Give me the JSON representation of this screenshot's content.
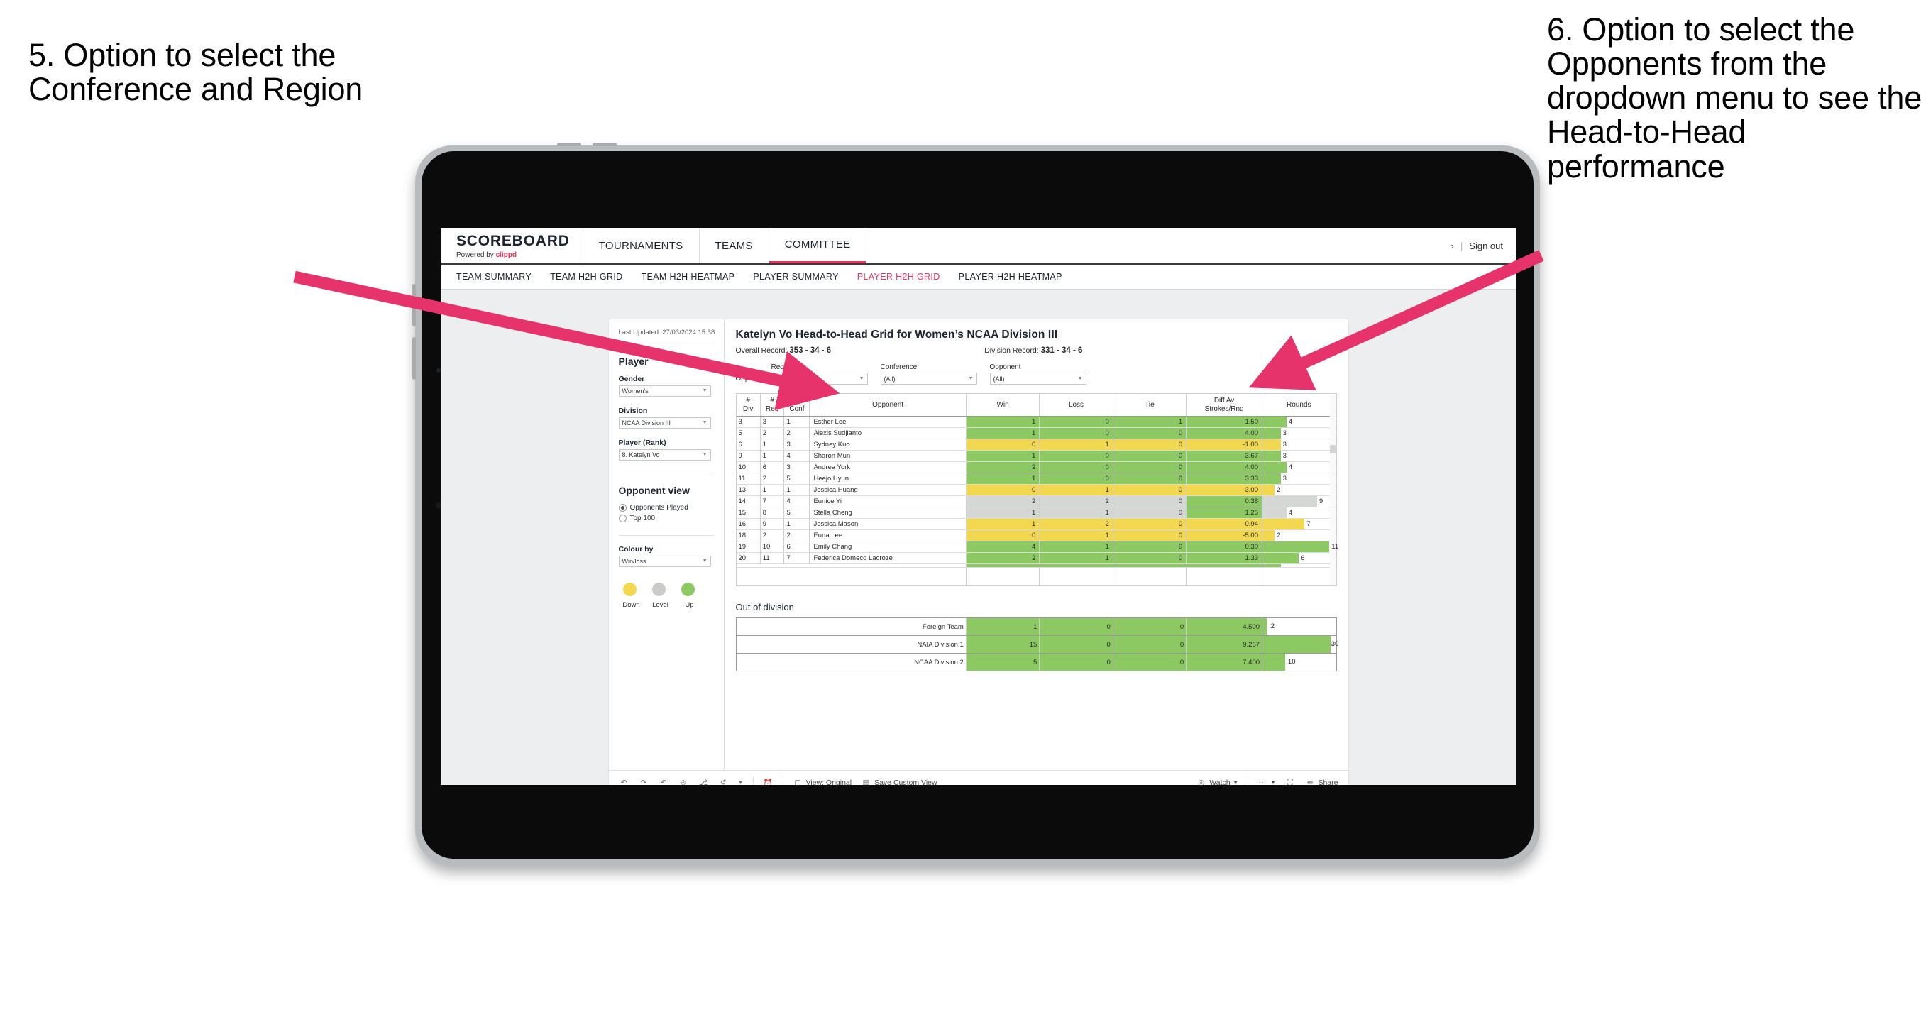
{
  "annotations": {
    "left": "5. Option to select the Conference and Region",
    "right": "6. Option to select the Opponents from the dropdown menu to see the Head-to-Head performance",
    "arrow_color": "#e6336b"
  },
  "app": {
    "logo": {
      "word": "SCOREBOARD",
      "powered_prefix": "Powered by ",
      "powered_brand": "clippd"
    },
    "topnav": [
      {
        "label": "TOURNAMENTS",
        "active": false
      },
      {
        "label": "TEAMS",
        "active": false
      },
      {
        "label": "COMMITTEE",
        "active": true
      }
    ],
    "topbar_right": {
      "chevron": "›",
      "separator": "|",
      "sign_out": "Sign out"
    },
    "subnav": [
      {
        "label": "TEAM SUMMARY",
        "active": false
      },
      {
        "label": "TEAM H2H GRID",
        "active": false
      },
      {
        "label": "TEAM H2H HEATMAP",
        "active": false
      },
      {
        "label": "PLAYER SUMMARY",
        "active": false
      },
      {
        "label": "PLAYER H2H GRID",
        "active": true
      },
      {
        "label": "PLAYER H2H HEATMAP",
        "active": false
      }
    ],
    "accent": "#e6355f"
  },
  "sidebar": {
    "last_updated": "Last Updated: 27/03/2024 15:38",
    "player_heading": "Player",
    "fields": [
      {
        "label": "Gender",
        "value": "Women’s"
      },
      {
        "label": "Division",
        "value": "NCAA Division III"
      },
      {
        "label": "Player (Rank)",
        "value": "8. Katelyn Vo"
      }
    ],
    "opponent_view": {
      "heading": "Opponent view",
      "options": [
        {
          "label": "Opponents Played",
          "selected": true
        },
        {
          "label": "Top 100",
          "selected": false
        }
      ]
    },
    "colour_by": {
      "label": "Colour by",
      "value": "Win/loss"
    },
    "legend": [
      {
        "label": "Down",
        "color": "#f2d84f"
      },
      {
        "label": "Level",
        "color": "#c9ccc9"
      },
      {
        "label": "Up",
        "color": "#8dc963"
      }
    ]
  },
  "main": {
    "title": "Katelyn Vo Head-to-Head Grid for Women’s NCAA Division III",
    "overall_record_label": "Overall Record:",
    "overall_record_value": "353 -  34 - 6",
    "division_record_label": "Division Record:",
    "division_record_value": "331 -  34 - 6",
    "opponents_label": "Opponents:",
    "filters": [
      {
        "name": "Region",
        "value": "(All)"
      },
      {
        "name": "Conference",
        "value": "(All)"
      },
      {
        "name": "Opponent",
        "value": "(All)"
      }
    ],
    "out_of_division_heading": "Out of division"
  },
  "chart_data": {
    "type": "table",
    "title": "Katelyn Vo Head-to-Head Grid for Women’s NCAA Division III",
    "columns": [
      "# Div",
      "# Reg",
      "# Conf",
      "Opponent",
      "Win",
      "Loss",
      "Tie",
      "Diff Av Strokes/Rnd",
      "Rounds"
    ],
    "column_headers_two_line": [
      {
        "top": "#",
        "bottom": "Div"
      },
      {
        "top": "#",
        "bottom": "Reg"
      },
      {
        "top": "#",
        "bottom": "Conf"
      },
      {
        "top": "",
        "bottom": "Opponent"
      },
      {
        "top": "",
        "bottom": "Win"
      },
      {
        "top": "",
        "bottom": "Loss"
      },
      {
        "top": "",
        "bottom": "Tie"
      },
      {
        "top": "Diff Av",
        "bottom": "Strokes/Rnd"
      },
      {
        "top": "",
        "bottom": "Rounds"
      }
    ],
    "rows_max_rounds": 12,
    "rows": [
      {
        "div": "3",
        "reg": "3",
        "conf": "1",
        "opponent": "Esther Lee",
        "win": "1",
        "loss": "0",
        "tie": "1",
        "diff": "1.50",
        "rounds": 4,
        "state": "up"
      },
      {
        "div": "5",
        "reg": "2",
        "conf": "2",
        "opponent": "Alexis Sudjianto",
        "win": "1",
        "loss": "0",
        "tie": "0",
        "diff": "4.00",
        "rounds": 3,
        "state": "up"
      },
      {
        "div": "6",
        "reg": "1",
        "conf": "3",
        "opponent": "Sydney Kuo",
        "win": "0",
        "loss": "1",
        "tie": "0",
        "diff": "-1.00",
        "rounds": 3,
        "state": "down"
      },
      {
        "div": "9",
        "reg": "1",
        "conf": "4",
        "opponent": "Sharon Mun",
        "win": "1",
        "loss": "0",
        "tie": "0",
        "diff": "3.67",
        "rounds": 3,
        "state": "up"
      },
      {
        "div": "10",
        "reg": "6",
        "conf": "3",
        "opponent": "Andrea York",
        "win": "2",
        "loss": "0",
        "tie": "0",
        "diff": "4.00",
        "rounds": 4,
        "state": "up"
      },
      {
        "div": "11",
        "reg": "2",
        "conf": "5",
        "opponent": "Heejo Hyun",
        "win": "1",
        "loss": "0",
        "tie": "0",
        "diff": "3.33",
        "rounds": 3,
        "state": "up"
      },
      {
        "div": "13",
        "reg": "1",
        "conf": "1",
        "opponent": "Jessica Huang",
        "win": "0",
        "loss": "1",
        "tie": "0",
        "diff": "-3.00",
        "rounds": 2,
        "state": "down"
      },
      {
        "div": "14",
        "reg": "7",
        "conf": "4",
        "opponent": "Eunice Yi",
        "win": "2",
        "loss": "2",
        "tie": "0",
        "diff": "0.38",
        "rounds": 9,
        "state": "level",
        "diff_state": "up"
      },
      {
        "div": "15",
        "reg": "8",
        "conf": "5",
        "opponent": "Stella Cheng",
        "win": "1",
        "loss": "1",
        "tie": "0",
        "diff": "1.25",
        "rounds": 4,
        "state": "level",
        "diff_state": "up"
      },
      {
        "div": "16",
        "reg": "9",
        "conf": "1",
        "opponent": "Jessica Mason",
        "win": "1",
        "loss": "2",
        "tie": "0",
        "diff": "-0.94",
        "rounds": 7,
        "state": "down"
      },
      {
        "div": "18",
        "reg": "2",
        "conf": "2",
        "opponent": "Euna Lee",
        "win": "0",
        "loss": "1",
        "tie": "0",
        "diff": "-5.00",
        "rounds": 2,
        "state": "down"
      },
      {
        "div": "19",
        "reg": "10",
        "conf": "6",
        "opponent": "Emily Chang",
        "win": "4",
        "loss": "1",
        "tie": "0",
        "diff": "0.30",
        "rounds": 11,
        "state": "up"
      },
      {
        "div": "20",
        "reg": "11",
        "conf": "7",
        "opponent": "Federica Domecq Lacroze",
        "win": "2",
        "loss": "1",
        "tie": "0",
        "diff": "1.33",
        "rounds": 6,
        "state": "up"
      }
    ],
    "out_of_division": {
      "max_rounds": 32,
      "rows": [
        {
          "name": "Foreign Team",
          "win": "1",
          "loss": "0",
          "tie": "0",
          "diff": "4.500",
          "rounds": 2,
          "state": "up"
        },
        {
          "name": "NAIA Division 1",
          "win": "15",
          "loss": "0",
          "tie": "0",
          "diff": "9.267",
          "rounds": 30,
          "state": "up"
        },
        {
          "name": "NCAA Division 2",
          "win": "5",
          "loss": "0",
          "tie": "0",
          "diff": "7.400",
          "rounds": 10,
          "state": "up"
        }
      ]
    },
    "colors": {
      "up": "#8dc963",
      "down": "#f2d84f",
      "level": "#d4d7d4",
      "white": "#ffffff"
    }
  },
  "toolbar": {
    "icons": [
      "undo-icon",
      "redo-icon",
      "revert-icon",
      "refresh-icon",
      "pause-icon",
      "reset-icon"
    ],
    "view_label": "View: Original",
    "save_label": "Save Custom View",
    "watch_label": "Watch",
    "share_label": "Share"
  }
}
